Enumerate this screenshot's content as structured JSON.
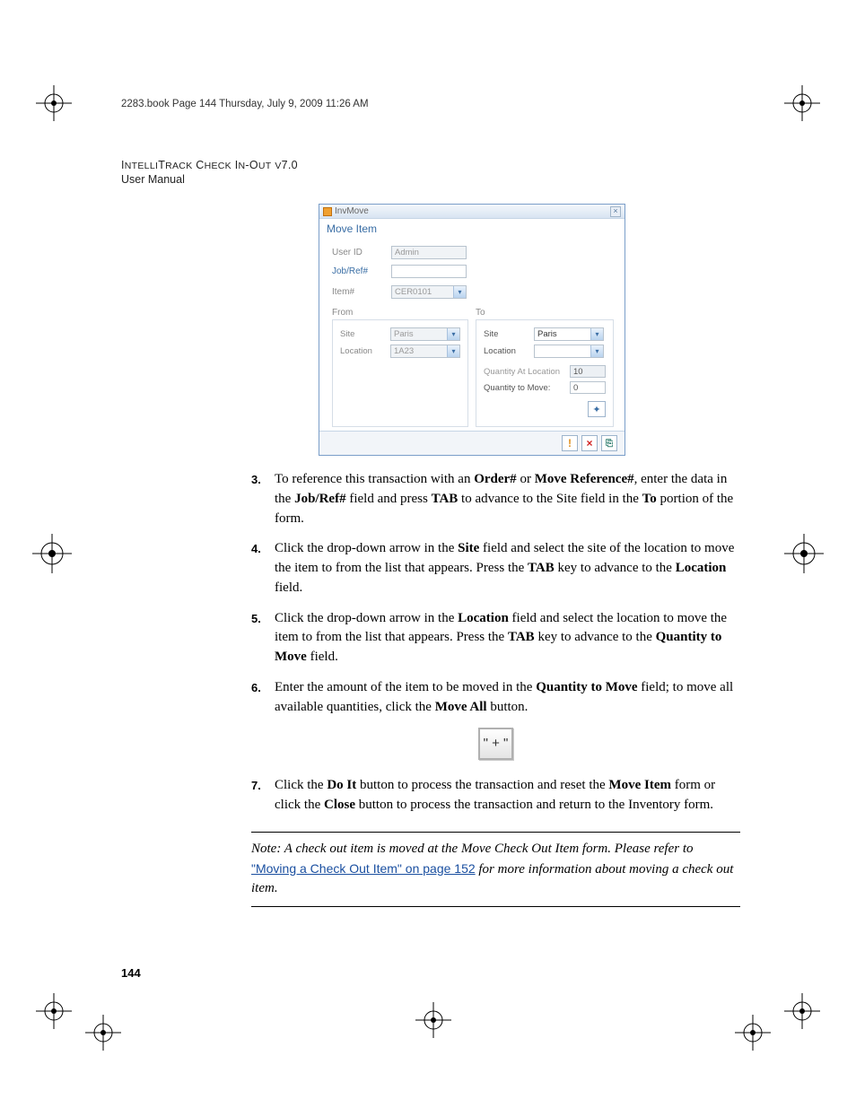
{
  "header_line": "2283.book  Page 144  Thursday, July 9, 2009  11:26 AM",
  "doc_title": "INTELLITRACK CHECK IN-OUT V7.0",
  "doc_subtitle": "User Manual",
  "window": {
    "titlebar": "InvMove",
    "form_title": "Move Item",
    "userid_label": "User ID",
    "userid_value": "Admin",
    "jobref_label": "Job/Ref#",
    "jobref_value": "",
    "item_label": "Item#",
    "item_value": "CER0101",
    "from_label": "From",
    "to_label": "To",
    "from_site_label": "Site",
    "from_site_value": "Paris",
    "from_loc_label": "Location",
    "from_loc_value": "1A23",
    "to_site_label": "Site",
    "to_site_value": "Paris",
    "to_loc_label": "Location",
    "to_loc_value": "",
    "qty_at_loc_label": "Quantity At Location",
    "qty_at_loc_value": "10",
    "qty_move_label": "Quantity to Move:",
    "qty_move_value": "0",
    "doit_icon": "!",
    "close_icon": "×",
    "exit_icon": "⎘"
  },
  "steps": {
    "s3": {
      "num": "3.",
      "pre": "To reference this transaction with an ",
      "b1": "Order#",
      "mid1": " or ",
      "b2": "Move Reference#",
      "mid2": ", enter the data in the ",
      "b3": "Job/Ref#",
      "mid3": " field and press ",
      "b4": "TAB",
      "mid4": " to advance to the Site field in the ",
      "b5": "To",
      "tail": " portion of the form."
    },
    "s4": {
      "num": "4.",
      "pre": "Click the drop-down arrow in the ",
      "b1": "Site",
      "mid1": " field and select the site of the location to move the item to from the list that appears. Press the ",
      "b2": "TAB",
      "mid2": " key to advance to the ",
      "b3": "Location",
      "tail": " field."
    },
    "s5": {
      "num": "5.",
      "pre": "Click the drop-down arrow in the ",
      "b1": "Location",
      "mid1": " field and select the location to move the item to from the list that appears. Press the ",
      "b2": "TAB",
      "mid2": " key to advance to the ",
      "b3": "Quantity to Move",
      "tail": " field."
    },
    "s6": {
      "num": "6.",
      "pre": "Enter the amount of the item to be moved in the ",
      "b1": "Quantity to Move",
      "mid1": " field; to move all available quantities, click the ",
      "b2": "Move All",
      "tail": " button."
    },
    "s7": {
      "num": "7.",
      "pre": "Click the ",
      "b1": "Do It",
      "mid1": " button to process the transaction and reset the ",
      "b2": "Move Item",
      "mid2": " form or click the ",
      "b3": "Close",
      "tail": " button to process the transaction and return to the Inventory form."
    }
  },
  "plus_icon_label": "\" + \"",
  "note": {
    "prefix": "Note:   A check out item is moved at the Move Check Out Item form. Please refer to ",
    "link": "\"Moving a Check Out Item\" on page 152",
    "suffix": " for more information about moving a check out item."
  },
  "page_number": "144"
}
